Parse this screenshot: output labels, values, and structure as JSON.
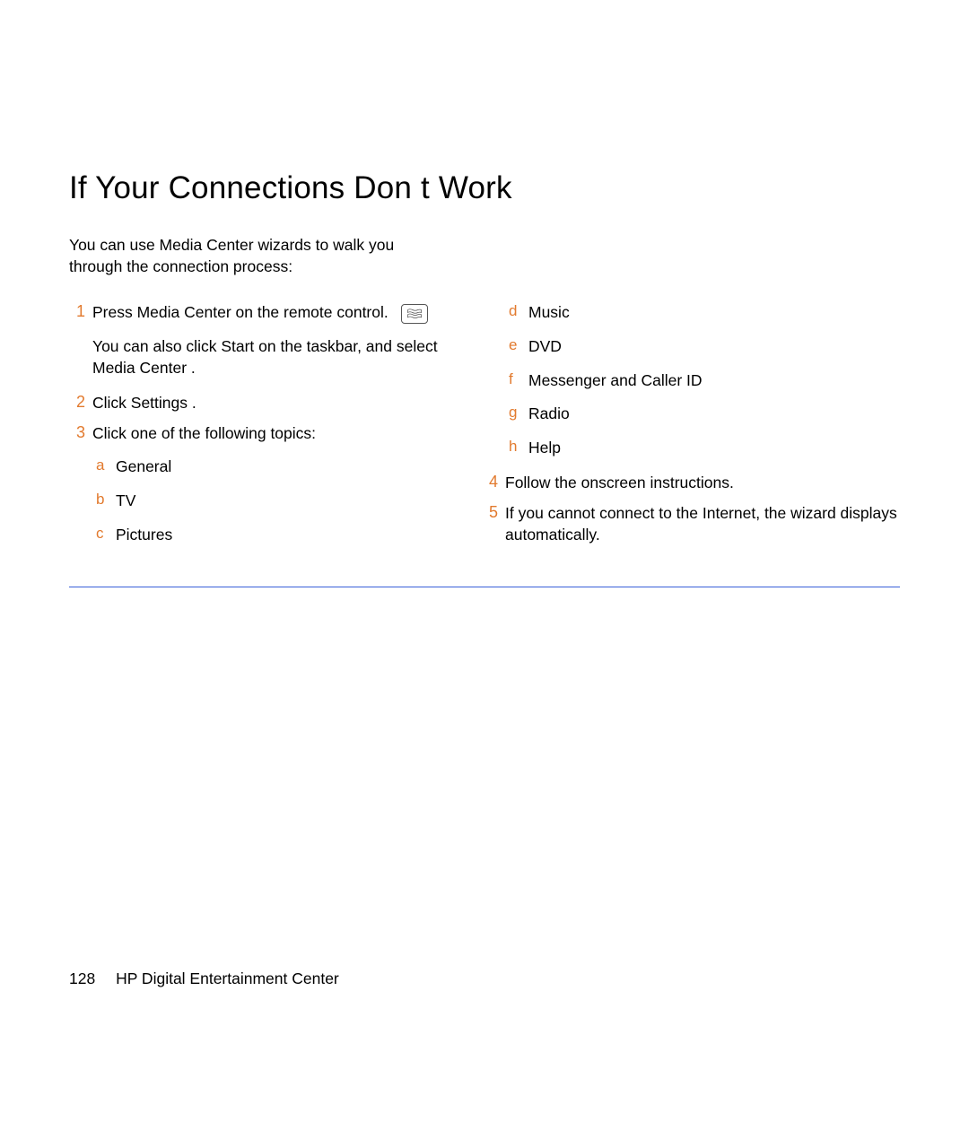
{
  "title": "If Your Connections Don t Work",
  "intro": "You can use Media Center wizards to walk you through the connection process:",
  "left": {
    "step1": {
      "num": "1",
      "text": "Press Media Center on the remote control.",
      "extra": "You can also click Start  on the taskbar, and select Media Center ."
    },
    "step2": {
      "num": "2",
      "text": "Click Settings ."
    },
    "step3": {
      "num": "3",
      "text": "Click one of the following topics:"
    },
    "subs": [
      {
        "letter": "a",
        "text": "General"
      },
      {
        "letter": "b",
        "text": "TV"
      },
      {
        "letter": "c",
        "text": "Pictures"
      }
    ]
  },
  "right": {
    "subs": [
      {
        "letter": "d",
        "text": "Music"
      },
      {
        "letter": "e",
        "text": "DVD"
      },
      {
        "letter": "f",
        "text": "Messenger and Caller ID"
      },
      {
        "letter": "g",
        "text": "Radio"
      },
      {
        "letter": "h",
        "text": "Help"
      }
    ],
    "step4": {
      "num": "4",
      "text": "Follow the onscreen instructions."
    },
    "step5": {
      "num": "5",
      "text": "If you cannot connect to the Internet, the wizard displays automatically."
    }
  },
  "footer": {
    "page": "128",
    "book": "HP Digital Entertainment Center"
  }
}
